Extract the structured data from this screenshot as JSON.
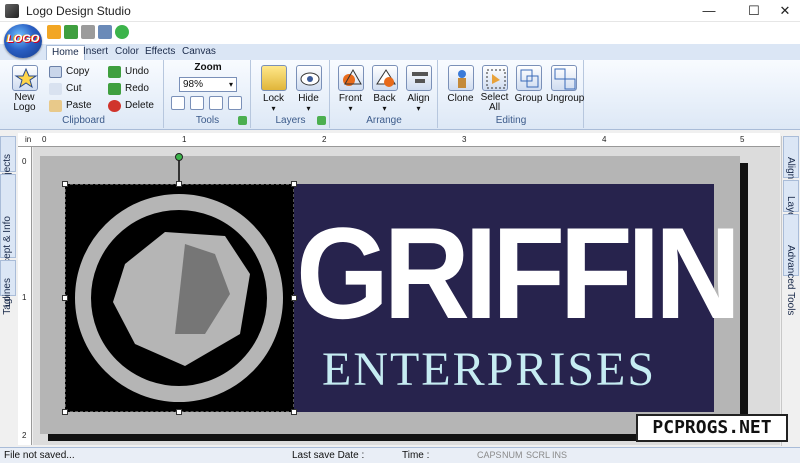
{
  "window": {
    "title": "Logo Design Studio",
    "min": "—",
    "max": "☐",
    "close": "✕"
  },
  "app_logo": "LOGO",
  "tabs": [
    "Home",
    "Insert",
    "Color",
    "Effects",
    "Canvas"
  ],
  "ribbon": {
    "new_logo": "New Logo",
    "copy": "Copy",
    "cut": "Cut",
    "paste": "Paste",
    "undo": "Undo",
    "redo": "Redo",
    "delete": "Delete",
    "clipboard_label": "Clipboard",
    "zoom_label": "Zoom",
    "zoom_value": "98%",
    "tools_label": "Tools",
    "lock": "Lock",
    "hide": "Hide",
    "layers_label": "Layers",
    "front": "Front",
    "back": "Back",
    "align": "Align",
    "arrange_label": "Arrange",
    "clone": "Clone",
    "select_all": "Select All",
    "group": "Group",
    "ungroup": "Ungroup",
    "editing_label": "Editing"
  },
  "ruler": {
    "unit": "in",
    "ticks": [
      "0",
      "1",
      "2",
      "3",
      "4",
      "5"
    ],
    "vticks": [
      "0",
      "1",
      "2"
    ]
  },
  "left_panes": [
    "Objects",
    "Logo Concept & Info",
    "Taglines"
  ],
  "right_panes": [
    "Alignment",
    "Layers",
    "Advanced Tools"
  ],
  "logo": {
    "title": "GRIFFIN",
    "subtitle": "ENTERPRISES"
  },
  "status": {
    "saved": "File not saved...",
    "last_save": "Last save Date :",
    "time": "Time :",
    "caps": "CAPS",
    "num": "NUM",
    "scrl": "SCRL",
    "ins": "INS"
  },
  "watermark": "PCPROGS.NET",
  "colors": {
    "ribbon_bg": "#dde8f6",
    "logo_left": "#000000",
    "logo_right": "#27234d",
    "subtitle": "#c6ecf2"
  }
}
